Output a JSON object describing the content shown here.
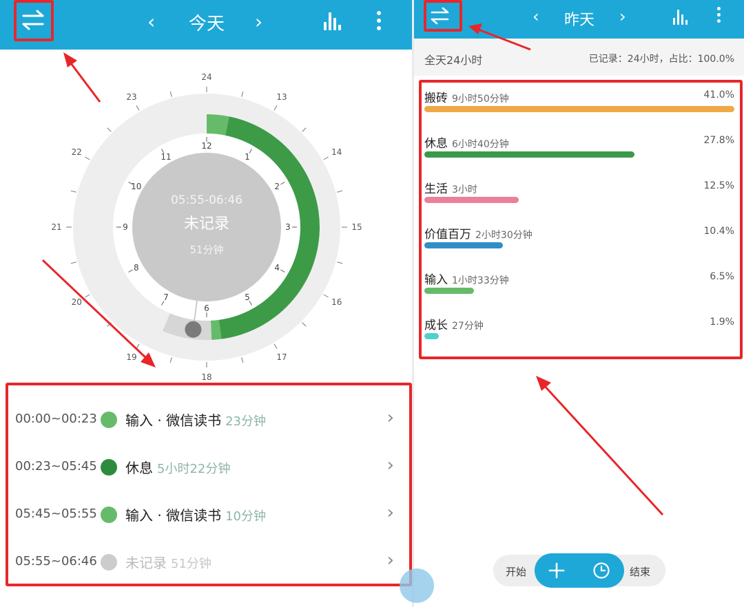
{
  "left": {
    "title": "今天",
    "prev": "‹",
    "next": "›",
    "clock": {
      "outer_ticks": [
        "24",
        "13",
        "14",
        "15",
        "16",
        "17",
        "18",
        "19",
        "20",
        "21",
        "22",
        "23"
      ],
      "inner_ticks": [
        "12",
        "1",
        "2",
        "3",
        "4",
        "5",
        "6",
        "7",
        "8",
        "9",
        "10",
        "11"
      ],
      "center_time": "05:55-06:46",
      "center_label": "未记录",
      "center_duration": "51分钟"
    },
    "entries": [
      {
        "time": "00:00~00:23",
        "name": "输入 · 微信读书",
        "duration": "23分钟",
        "color": "#66bb6a",
        "muted": false
      },
      {
        "time": "00:23~05:45",
        "name": "休息",
        "duration": "5小时22分钟",
        "color": "#2e8b3e",
        "muted": false
      },
      {
        "time": "05:45~05:55",
        "name": "输入 · 微信读书",
        "duration": "10分钟",
        "color": "#66bb6a",
        "muted": false
      },
      {
        "time": "05:55~06:46",
        "name": "未记录",
        "duration": "51分钟",
        "color": "#cccccc",
        "muted": true
      }
    ],
    "chevron": "›"
  },
  "right": {
    "title": "昨天",
    "prev": "‹",
    "next": "›",
    "summary_left": "全天24小时",
    "summary_right": "已记录：24小时，占比：100.0%",
    "stats": [
      {
        "name": "搬砖",
        "duration": "9小时50分钟",
        "percent": "41.0%",
        "fraction": 1.0,
        "color": "#f0a846"
      },
      {
        "name": "休息",
        "duration": "6小时40分钟",
        "percent": "27.8%",
        "fraction": 0.678,
        "color": "#3a9a4a"
      },
      {
        "name": "生活",
        "duration": "3小时",
        "percent": "12.5%",
        "fraction": 0.305,
        "color": "#ec7f9a"
      },
      {
        "name": "价值百万",
        "duration": "2小时30分钟",
        "percent": "10.4%",
        "fraction": 0.254,
        "color": "#2f8ec8"
      },
      {
        "name": "输入",
        "duration": "1小时33分钟",
        "percent": "6.5%",
        "fraction": 0.159,
        "color": "#66bb6a"
      },
      {
        "name": "成长",
        "duration": "27分钟",
        "percent": "1.9%",
        "fraction": 0.046,
        "color": "#4fd0d0"
      }
    ],
    "bottom": {
      "start": "开始",
      "end": "结束"
    }
  },
  "colors": {
    "accent": "#1ea8d8",
    "annotation": "#e8262a"
  }
}
